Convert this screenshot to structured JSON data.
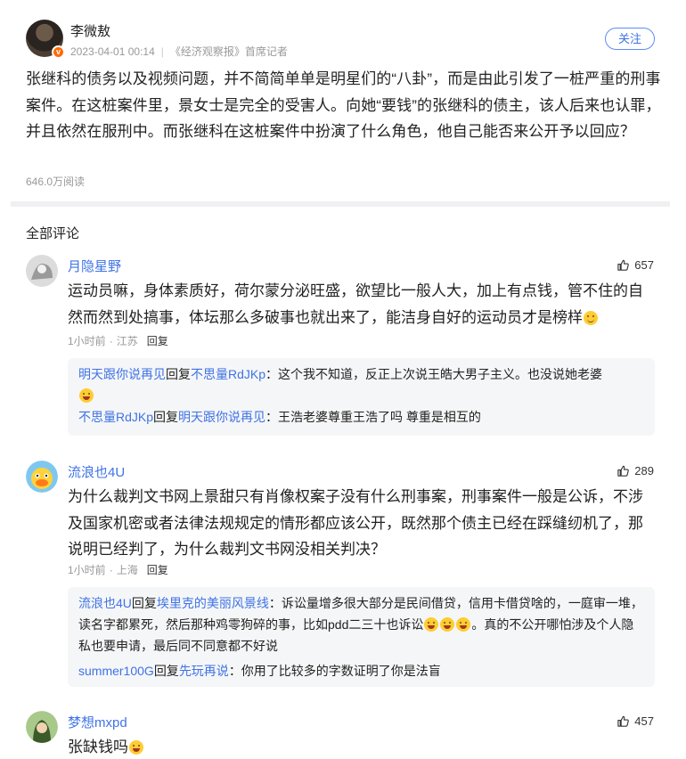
{
  "post": {
    "author": "李微敖",
    "timestamp": "2023-04-01 00:14",
    "source": "《经济观察报》首席记者",
    "follow_label": "关注",
    "body": "张继科的债务以及视频问题，并不简简单单是明星们的“八卦”，而是由此引发了一桩严重的刑事案件。在这桩案件里，景女士是完全的受害人。向她“要钱”的张继科的债主，该人后来也认罪，并且依然在服刑中。而张继科在这桩案件中扮演了什么角色，他自己能否来公开予以回应？",
    "views": "646.0万阅读"
  },
  "comments_section": {
    "title": "全部评论"
  },
  "comments": [
    {
      "user": "月隐星野",
      "likes": "657",
      "text": "运动员嘛，身体素质好，荷尔蒙分泌旺盛，欲望比一般人大，加上有点钱，管不住的自然而然到处搞事，体坛那么多破事也就出来了，能洁身自好的运动员才是榜样",
      "time": "1小时前",
      "location": "江苏",
      "reply_label": "回复",
      "replies": [
        {
          "from": "明天跟你说再见",
          "verb": "回复",
          "to": "不思量RdJKp",
          "text": "：这个我不知道，反正上次说王皓大男子主义。也没说她老婆"
        },
        {
          "from": "不思量RdJKp",
          "verb": "回复",
          "to": "明天跟你说再见",
          "text": "：王浩老婆尊重王浩了吗 尊重是相互的"
        }
      ]
    },
    {
      "user": "流浪也4U",
      "likes": "289",
      "text": "为什么裁判文书网上景甜只有肖像权案子没有什么刑事案，刑事案件一般是公诉，不涉及国家机密或者法律法规规定的情形都应该公开，既然那个债主已经在踩缝纫机了，那说明已经判了，为什么裁判文书网没相关判决？",
      "time": "1小时前",
      "location": "上海",
      "reply_label": "回复",
      "replies": [
        {
          "from": "流浪也4U",
          "verb": "回复",
          "to": "埃里克的美丽风景线",
          "text": "：诉讼量增多很大部分是民间借贷，信用卡借贷啥的，一庭审一堆，读名字都累死，然后那种鸡零狗碎的事，比如pdd二三十也诉讼",
          "text_after": "。真的不公开哪怕涉及个人隐私也要申请，最后同不同意都不好说"
        },
        {
          "from": "summer100G",
          "verb": "回复",
          "to": "先玩再说",
          "text": "：你用了比较多的字数证明了你是法盲"
        }
      ]
    },
    {
      "user": "梦想mxpd",
      "likes": "457",
      "text": "张缺钱吗"
    }
  ]
}
